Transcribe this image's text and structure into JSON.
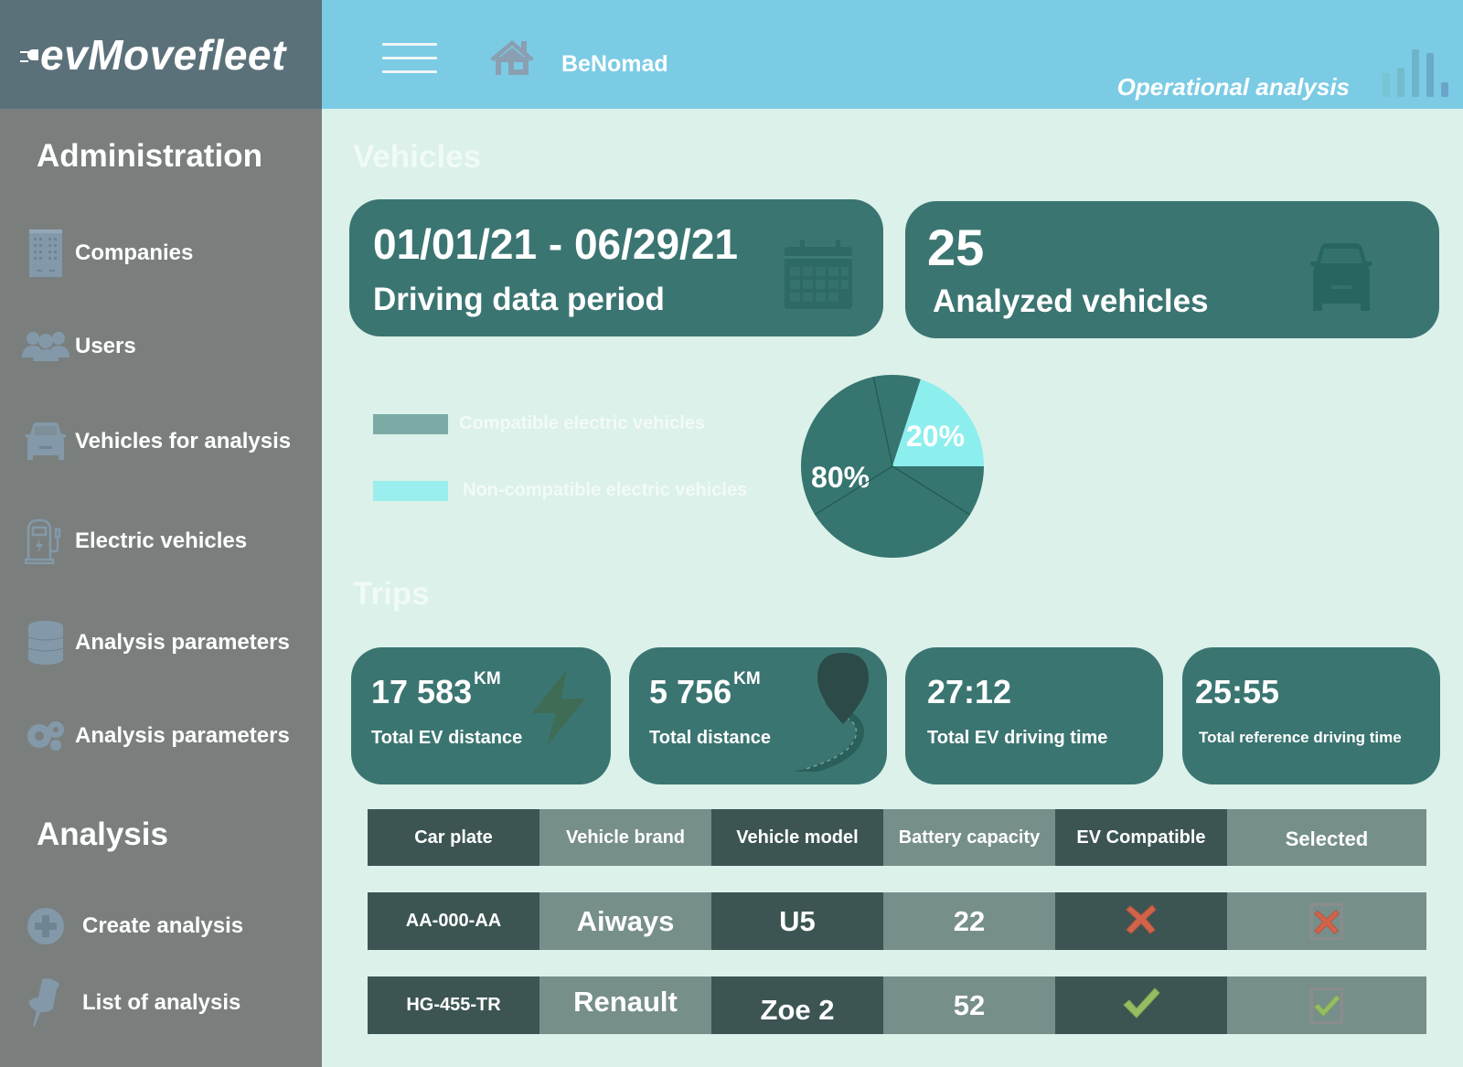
{
  "app": {
    "logo": "evMovefleet",
    "company": "BeNomad",
    "page_context": "Operational analysis"
  },
  "sidebar": {
    "administration_heading": "Administration",
    "admin_items": [
      {
        "label": "Companies",
        "icon": "building-icon"
      },
      {
        "label": "Users",
        "icon": "users-icon"
      },
      {
        "label": "Vehicles for analysis",
        "icon": "car-icon"
      },
      {
        "label": "Electric vehicles",
        "icon": "charging-station-icon"
      },
      {
        "label": "Analysis parameters",
        "icon": "database-icon"
      },
      {
        "label": "Analysis parameters",
        "icon": "gears-icon"
      }
    ],
    "analysis_heading": "Analysis",
    "analysis_items": [
      {
        "label": "Create analysis",
        "icon": "plus-circle-icon"
      },
      {
        "label": "List of analysis",
        "icon": "pushpin-icon"
      }
    ]
  },
  "vehicles": {
    "title": "Vehicles",
    "period": {
      "value": "01/01/21 - 06/29/21",
      "label": "Driving data period"
    },
    "analyzed": {
      "value": "25",
      "label": "Analyzed vehicles"
    }
  },
  "chart_data": {
    "type": "pie",
    "title": "",
    "slices": [
      {
        "name": "Compatible electric vehicles",
        "value": 80,
        "label": "80%",
        "color": "#367570"
      },
      {
        "name": "Non-compatible electric vehicles",
        "value": 20,
        "label": "20%",
        "color": "#8deeee"
      }
    ],
    "legend": [
      {
        "label": "Compatible electric vehicles",
        "color": "#7caba5"
      },
      {
        "label": "Non-compatible electric vehicles",
        "color": "#9aeeee"
      }
    ],
    "legend_position": "left"
  },
  "trips": {
    "title": "Trips",
    "cards": [
      {
        "value": "17 583",
        "unit": "KM",
        "label": "Total EV distance",
        "icon": "lightning-icon"
      },
      {
        "value": "5 756",
        "unit": "KM",
        "label": "Total distance",
        "icon": "road-pin-icon"
      },
      {
        "value": "27:12",
        "unit": "",
        "label": "Total EV driving time"
      },
      {
        "value": "25:55",
        "unit": "",
        "label": "Total reference driving time"
      }
    ]
  },
  "table": {
    "columns": [
      "Car plate",
      "Vehicle brand",
      "Vehicle model",
      "Battery capacity",
      "EV Compatible",
      "Selected"
    ],
    "rows": [
      {
        "plate": "AA-000-AA",
        "brand": "Aiways",
        "model": "U5",
        "battery": "22",
        "ev_compatible": false,
        "selected": false
      },
      {
        "plate": "HG-455-TR",
        "brand": "Renault",
        "model": "Zoe 2",
        "battery": "52",
        "ev_compatible": true,
        "selected": true
      }
    ]
  },
  "colors": {
    "header": "#7bcbe5",
    "logo_bg": "#5b717a",
    "sidebar": "#7a7f7e",
    "main_bg": "#dbf1ea",
    "card": "#3b7571",
    "icon_gray_blue": "#8399a9",
    "cross": "#d0644a",
    "check": "#97bd62"
  }
}
